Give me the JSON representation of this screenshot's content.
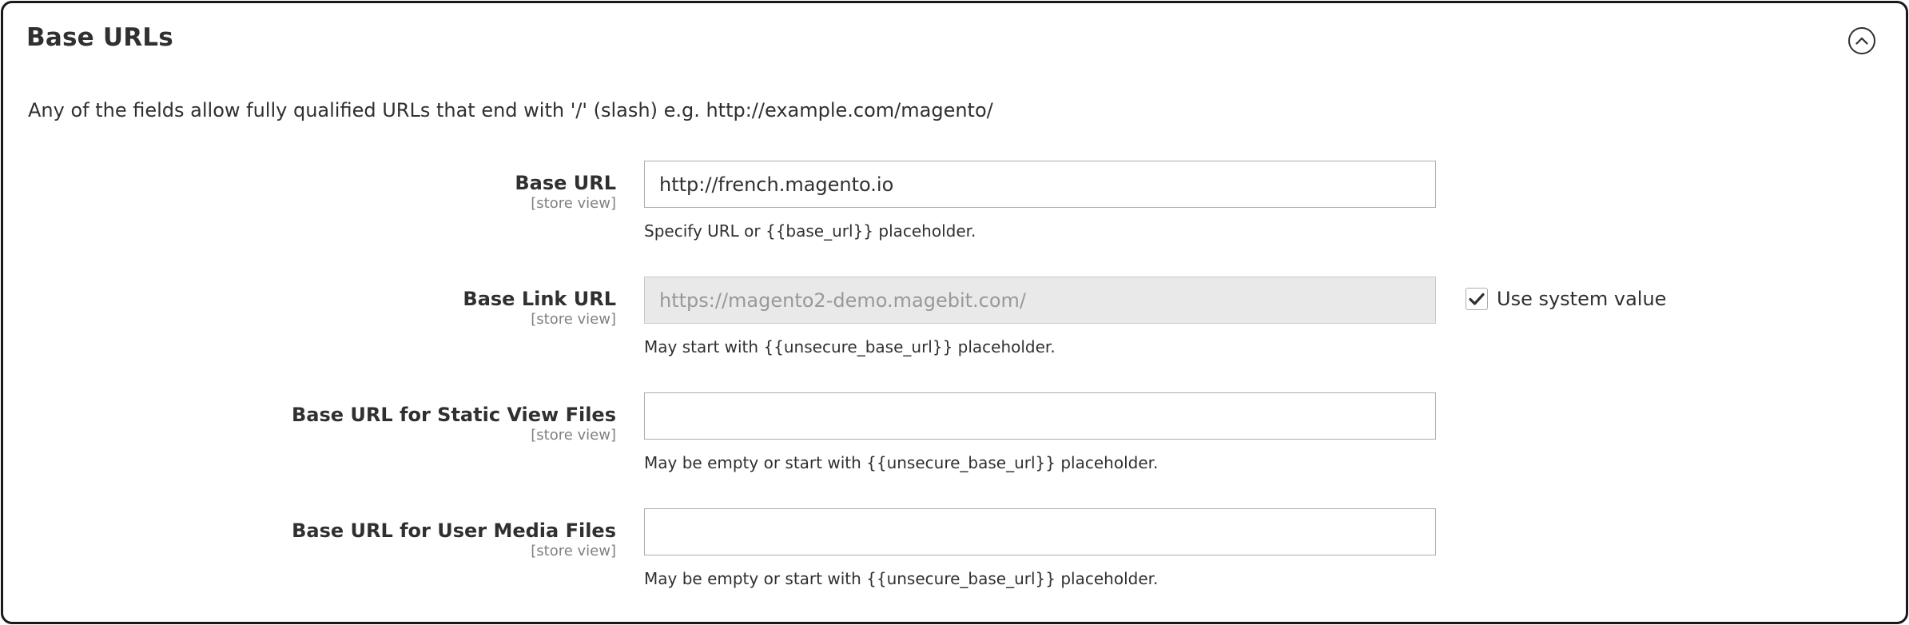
{
  "section": {
    "title": "Base URLs",
    "collapse_icon": "chevron-up-circle-icon",
    "description": "Any of the fields allow fully qualified URLs that end with '/' (slash) e.g. http://example.com/magento/"
  },
  "fields": [
    {
      "label": "Base URL",
      "scope": "[store view]",
      "value": "http://french.magento.io",
      "placeholder": "",
      "disabled": false,
      "note": "Specify URL or {{base_url}} placeholder."
    },
    {
      "label": "Base Link URL",
      "scope": "[store view]",
      "value": "https://magento2-demo.magebit.com/",
      "placeholder": "",
      "disabled": true,
      "note": "May start with {{unsecure_base_url}} placeholder.",
      "use_system_value": {
        "label": "Use system value",
        "checked": true,
        "icon": "checkmark-icon"
      }
    },
    {
      "label": "Base URL for Static View Files",
      "scope": "[store view]",
      "value": "",
      "placeholder": "",
      "disabled": false,
      "note": "May be empty or start with {{unsecure_base_url}} placeholder."
    },
    {
      "label": "Base URL for User Media Files",
      "scope": "[store view]",
      "value": "",
      "placeholder": "",
      "disabled": false,
      "note": "May be empty or start with {{unsecure_base_url}} placeholder."
    }
  ]
}
